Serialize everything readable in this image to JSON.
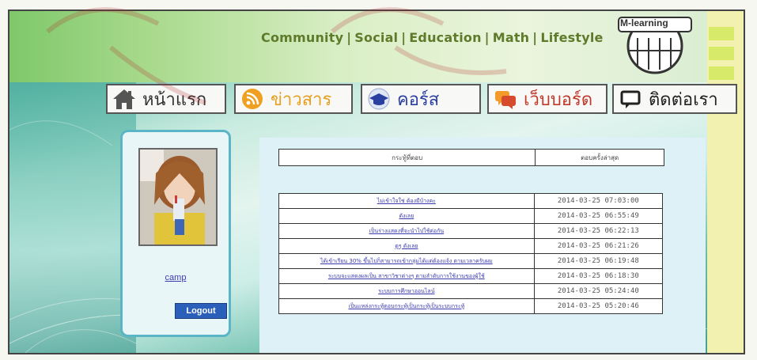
{
  "header": {
    "links": [
      {
        "label": "Community"
      },
      {
        "label": "Social"
      },
      {
        "label": "Education"
      },
      {
        "label": "Math"
      },
      {
        "label": "Lifestyle"
      }
    ],
    "separator": "|",
    "logo_label": "M-learning"
  },
  "nav": {
    "items": [
      {
        "label": "หน้าแรก",
        "icon": "home-icon",
        "color": "#333333"
      },
      {
        "label": "ข่าวสาร",
        "icon": "rss-icon",
        "color": "#e8a020"
      },
      {
        "label": "คอร์ส",
        "icon": "graduation-cap-icon",
        "color": "#2a3fa0"
      },
      {
        "label": "เว็บบอร์ด",
        "icon": "chat-bubbles-icon",
        "color": "#c0392b"
      },
      {
        "label": "ติดต่อเรา",
        "icon": "chat-window-icon",
        "color": "#222222"
      }
    ]
  },
  "profile": {
    "username": "camp",
    "logout_label": "Logout"
  },
  "board": {
    "col_topic": "กระทู้ที่ตอบ",
    "col_date": "ตอบครั้งล่าสุด",
    "rows": [
      {
        "topic": "ไม่เข้าใจใช่ ต้องมีบ้างคะ",
        "date": "2014-03-25 07:03:00"
      },
      {
        "topic": "ดังเลย",
        "date": "2014-03-25 06:55:49"
      },
      {
        "topic": "เป็นร่างแสดงที่จะนำไปใช้ต่อกัน",
        "date": "2014-03-25 06:22:13"
      },
      {
        "topic": "ดูๆ ดังเลย",
        "date": "2014-03-25 06:21:26"
      },
      {
        "topic": "ได้เข้าเรียน 30% ขึ้นไปก็สามารถเข้ากลุ่มได้แต่ต้องแจ้ง ตามเวลาครับผม",
        "date": "2014-03-25 06:19:48"
      },
      {
        "topic": "ระบบจะแสดงผลเป็น สาขาวิชาต่างๆ ตามลำดับการใช้งานของผู้ใช้",
        "date": "2014-03-25 06:18:30"
      },
      {
        "topic": "ระบบการศึกษาออนไลน์",
        "date": "2014-03-25 05:24:40"
      },
      {
        "topic": "เป็นแหล่งกระทู้ตอบกระทู้เป็นกระทู้เป็นระบบกระทู้",
        "date": "2014-03-25 05:20:46"
      }
    ]
  },
  "colors": {
    "header_text": "#5e7a2a",
    "link": "#3b3bb0",
    "logout_bg": "#2a5fba",
    "panel_border": "#5ab5c7"
  }
}
